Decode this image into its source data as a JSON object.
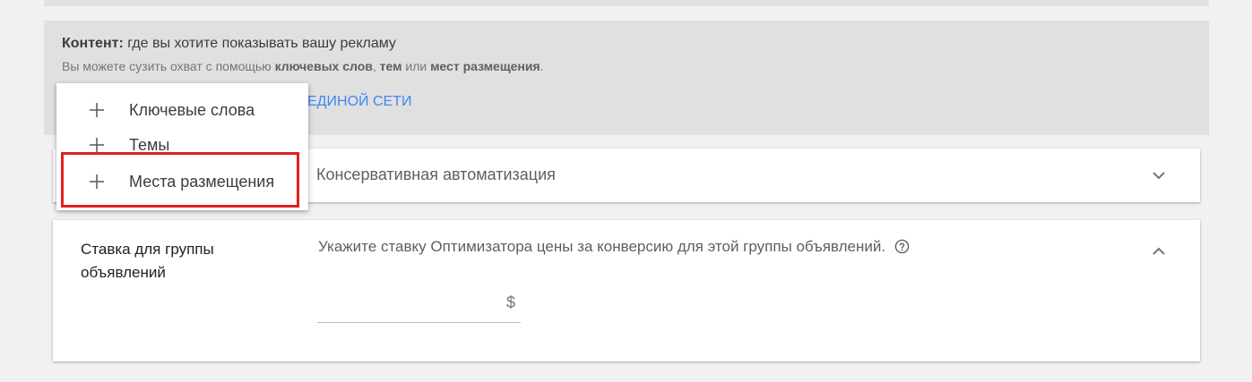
{
  "content": {
    "title_bold": "Контент:",
    "title_rest": " где вы хотите показывать вашу рекламу",
    "subtitle_part1": "Вы можете сузить охват с помощью ",
    "subtitle_keywords": "ключевых слов",
    "subtitle_sep1": ", ",
    "subtitle_topics": "тем",
    "subtitle_or": " или ",
    "subtitle_placements": "мест размещения",
    "subtitle_end": ".",
    "network_link_visible": "ЕДИНОЙ СЕТИ"
  },
  "menu": {
    "items": [
      {
        "label": "Ключевые слова",
        "icon": "plus-icon"
      },
      {
        "label": "Темы",
        "icon": "plus-icon"
      },
      {
        "label": "Места размещения",
        "icon": "plus-icon"
      }
    ],
    "highlighted_index": 2,
    "highlight_color": "#e02020"
  },
  "automation": {
    "value": "Консервативная автоматизация",
    "icon": "chevron-down-icon"
  },
  "bid": {
    "label": "Ставка для группы объявлений",
    "instruction": "Укажите ставку Оптимизатора цены за конверсию для этой группы объявлений.",
    "help_icon": "help-circle-icon",
    "input_value": "",
    "currency": "$",
    "icon": "chevron-up-icon"
  },
  "colors": {
    "link": "#4285f4",
    "panel_bg": "#e0e0e0",
    "page_bg": "#f1f1f1"
  }
}
